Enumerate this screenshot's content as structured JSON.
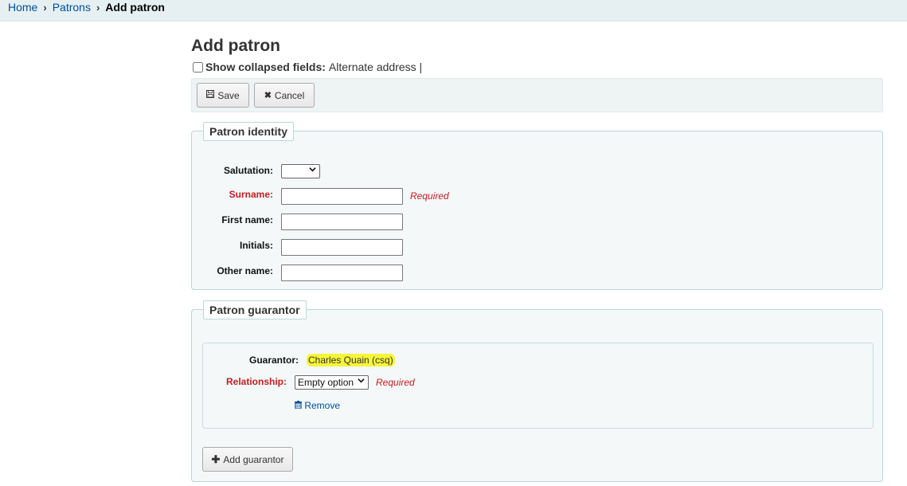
{
  "breadcrumb": {
    "home": "Home",
    "patrons": "Patrons",
    "current": "Add patron",
    "separator": "›"
  },
  "page": {
    "title": "Add patron",
    "show_collapsed_label": "Show collapsed fields:",
    "collapsed_links": "Alternate address |"
  },
  "toolbar": {
    "save_label": "Save",
    "save_icon": "floppy-disk-icon",
    "cancel_label": "Cancel",
    "cancel_icon": "close-icon"
  },
  "identity": {
    "legend": "Patron identity",
    "salutation_label": "Salutation:",
    "salutation_value": "",
    "surname_label": "Surname:",
    "surname_value": "",
    "surname_required": "Required",
    "firstname_label": "First name:",
    "firstname_value": "",
    "initials_label": "Initials:",
    "initials_value": "",
    "othername_label": "Other name:",
    "othername_value": ""
  },
  "guarantor": {
    "legend": "Patron guarantor",
    "guarantor_label": "Guarantor:",
    "guarantor_value": "Charles Quain (csq)",
    "relationship_label": "Relationship:",
    "relationship_value": "Empty option",
    "relationship_required": "Required",
    "remove_label": "Remove",
    "remove_icon": "trash-icon",
    "add_label": "Add guarantor",
    "add_icon": "plus-icon"
  },
  "colors": {
    "required": "#c31d1d",
    "link": "#004d99",
    "fieldset_border": "#b9d8d9",
    "highlight": "#f6f53a"
  }
}
